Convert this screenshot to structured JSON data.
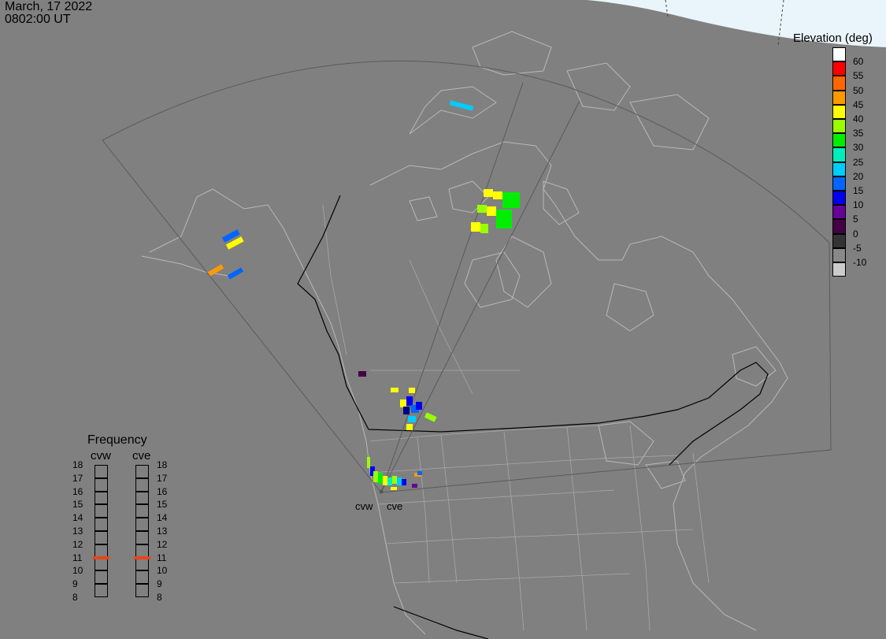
{
  "header": {
    "date": "March, 17 2022",
    "time": "0802:00 UT"
  },
  "colorbar": {
    "title": "Elevation (deg)",
    "ticks": [
      "60",
      "55",
      "50",
      "45",
      "40",
      "35",
      "30",
      "25",
      "20",
      "15",
      "10",
      "5",
      "0",
      "-5",
      "-10"
    ],
    "colors": [
      "#ffffff",
      "#ff0000",
      "#ff6600",
      "#ff9900",
      "#ffff00",
      "#99ff00",
      "#00ee00",
      "#00eebb",
      "#00ccff",
      "#0066ff",
      "#0000ee",
      "#660099",
      "#440044",
      "#333333",
      "#888888",
      "#cccccc"
    ]
  },
  "frequency": {
    "title": "Frequency",
    "radars": [
      {
        "name": "cvw",
        "selected_mhz": 11
      },
      {
        "name": "cve",
        "selected_mhz": 11
      }
    ],
    "scale_mhz": [
      "18",
      "17",
      "16",
      "15",
      "14",
      "13",
      "12",
      "11",
      "10",
      "9",
      "8"
    ]
  },
  "map": {
    "radar_labels": [
      "cvw",
      "cve"
    ],
    "colors": {
      "land": "#808080",
      "sea": "#808080",
      "borders": "#b5b5b5",
      "national_border": "#000000",
      "fov": "#5a5a5a",
      "daylight": "#eaf4fb"
    }
  }
}
